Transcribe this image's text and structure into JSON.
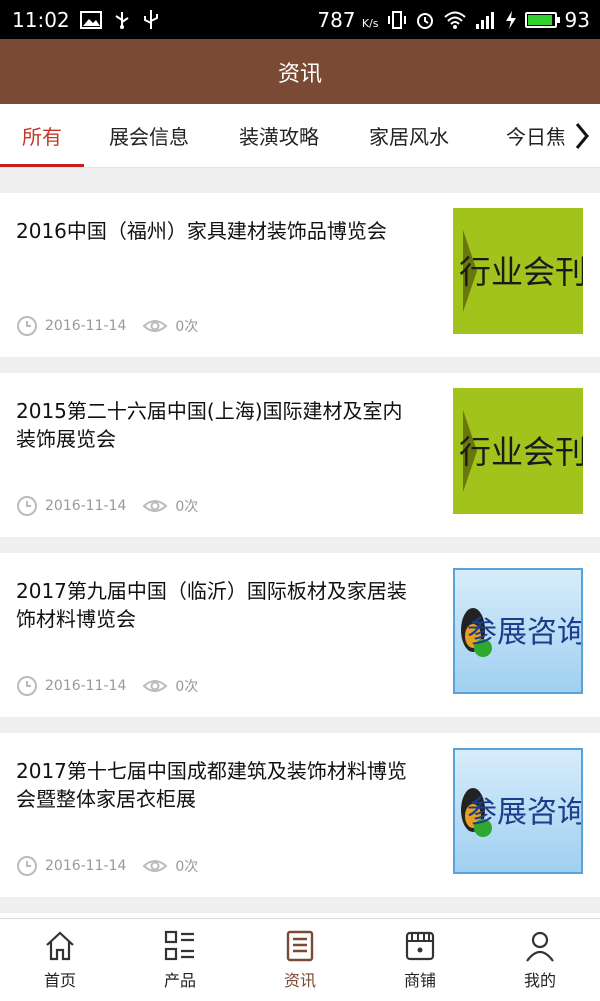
{
  "status_bar": {
    "time": "11:02",
    "speed": "787",
    "speed_unit": "K/s",
    "battery": "93",
    "battery_level": 0.93,
    "icons": [
      "image-icon",
      "usb-icon",
      "vibrate-icon",
      "alarm-icon",
      "wifi-icon",
      "signal-icon",
      "charging-icon",
      "battery-icon"
    ]
  },
  "header": {
    "title": "资讯"
  },
  "tabs": [
    {
      "label": "所有",
      "active": true
    },
    {
      "label": "展会信息",
      "active": false
    },
    {
      "label": "装潢攻略",
      "active": false
    },
    {
      "label": "家居风水",
      "active": false
    },
    {
      "label": "今日焦",
      "active": false
    }
  ],
  "articles": [
    {
      "title": "2016中国（福州）家具建材装饰品博览会",
      "date": "2016-11-14",
      "views": "0次",
      "thumb_text": "行业会刊"
    },
    {
      "title": "2015第二十六届中国(上海)国际建材及室内装饰展览会",
      "date": "2016-11-14",
      "views": "0次",
      "thumb_text": "行业会刊"
    },
    {
      "title": "2017第九届中国（临沂）国际板材及家居装饰材料博览会",
      "date": "2016-11-14",
      "views": "0次",
      "thumb_text": "参展咨询"
    },
    {
      "title": "2017第十七届中国成都建筑及装饰材料博览会暨整体家居衣柜展",
      "date": "2016-11-14",
      "views": "0次",
      "thumb_text": "参展咨询"
    }
  ],
  "bottom_nav": [
    {
      "label": "首页",
      "icon": "home-icon",
      "active": false
    },
    {
      "label": "产品",
      "icon": "grid-list-icon",
      "active": false
    },
    {
      "label": "资讯",
      "icon": "news-icon",
      "active": true
    },
    {
      "label": "商铺",
      "icon": "store-icon",
      "active": false
    },
    {
      "label": "我的",
      "icon": "user-icon",
      "active": false
    }
  ],
  "colors": {
    "header_bg": "#7a4a34",
    "tab_active": "#c81e1e",
    "nav_active": "#7a4a34",
    "thumb_green": "#a2c21c"
  }
}
